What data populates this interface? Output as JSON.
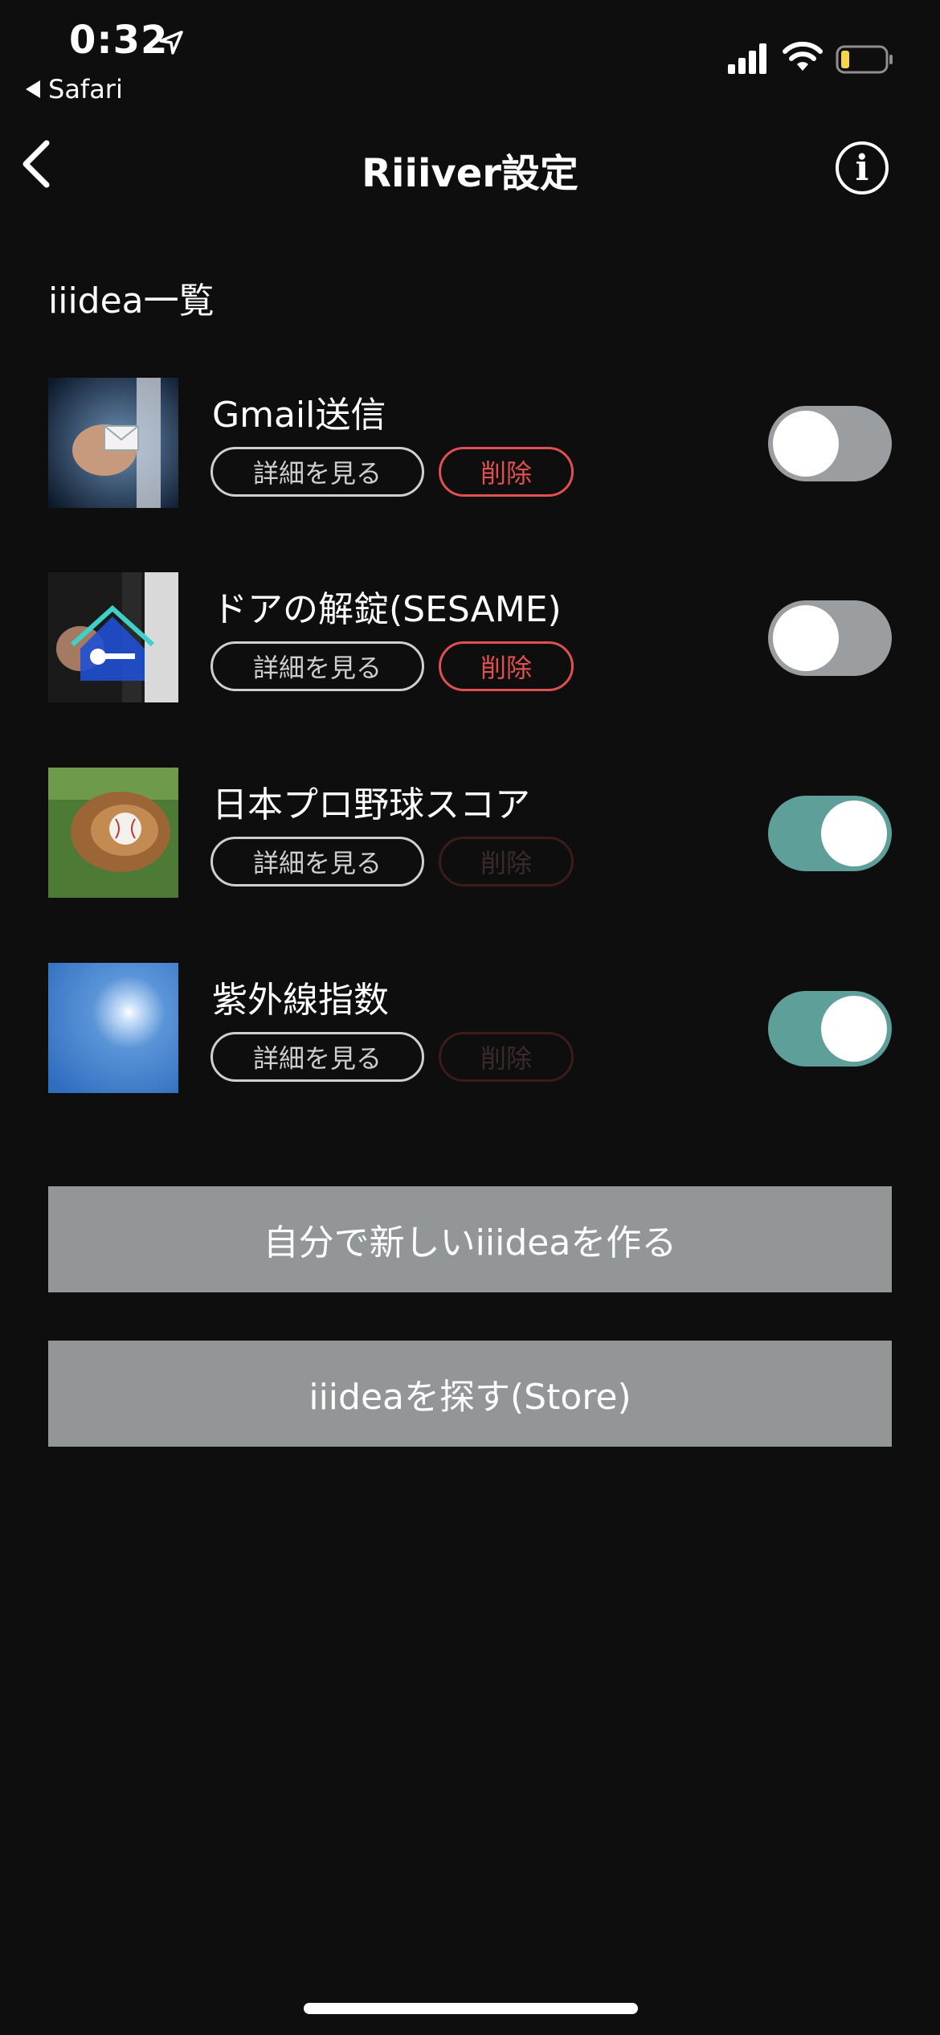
{
  "status_bar": {
    "time": "0:32",
    "back_app": "Safari",
    "battery_color": "#f5d547"
  },
  "nav": {
    "title": "Riiiver設定",
    "info_label": "i"
  },
  "section": {
    "title": "iiidea一覧"
  },
  "items": [
    {
      "title": "Gmail送信",
      "detail_label": "詳細を見る",
      "delete_label": "削除",
      "delete_enabled": true,
      "toggle_on": false,
      "thumb_icon": "gmail-thumb"
    },
    {
      "title": "ドアの解錠(SESAME)",
      "detail_label": "詳細を見る",
      "delete_label": "削除",
      "delete_enabled": true,
      "toggle_on": false,
      "thumb_icon": "door-key-thumb"
    },
    {
      "title": "日本プロ野球スコア",
      "detail_label": "詳細を見る",
      "delete_label": "削除",
      "delete_enabled": false,
      "toggle_on": true,
      "thumb_icon": "baseball-glove-thumb"
    },
    {
      "title": "紫外線指数",
      "detail_label": "詳細を見る",
      "delete_label": "削除",
      "delete_enabled": false,
      "toggle_on": true,
      "thumb_icon": "sun-sky-thumb"
    }
  ],
  "actions": {
    "create_label": "自分で新しいiiideaを作る",
    "store_label": "iiideaを探す(Store)"
  },
  "colors": {
    "background": "#0e0e0e",
    "toggle_on": "#5f9f9a",
    "toggle_off": "#9b9ea1",
    "delete_red": "#e05050",
    "action_button": "#929697"
  }
}
